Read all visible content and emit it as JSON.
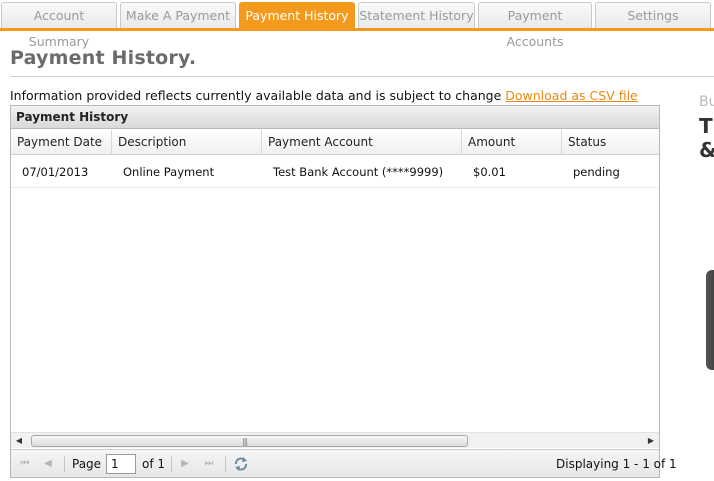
{
  "tabs": [
    {
      "label": "Account Summary",
      "active": false
    },
    {
      "label": "Make A Payment",
      "active": false
    },
    {
      "label": "Payment History",
      "active": true
    },
    {
      "label": "Statement History",
      "active": false
    },
    {
      "label": "Payment Accounts",
      "active": false
    },
    {
      "label": "Settings",
      "active": false
    }
  ],
  "page": {
    "title": "Payment History.",
    "info_text": "Information provided reflects currently available data and is subject to change",
    "download_link": "Download as CSV file"
  },
  "grid": {
    "title": "Payment History",
    "columns": [
      "Payment Date",
      "Description",
      "Payment Account",
      "Amount",
      "Status"
    ],
    "rows": [
      [
        "07/01/2013",
        "Online Payment",
        "Test Bank Account (****9999)",
        "$0.01",
        "pending"
      ]
    ]
  },
  "pager": {
    "page_label": "Page",
    "page_value": "1",
    "of_label": "of 1",
    "display_text": "Displaying 1 - 1 of 1"
  },
  "ad": {
    "small_text": "Bu",
    "line1": "T",
    "line2": "&"
  },
  "colors": {
    "accent": "#f39a1d",
    "link": "#e88a12"
  },
  "icons": [
    "first-page-icon",
    "prev-page-icon",
    "next-page-icon",
    "last-page-icon",
    "refresh-icon",
    "scroll-left-icon",
    "scroll-right-icon"
  ]
}
